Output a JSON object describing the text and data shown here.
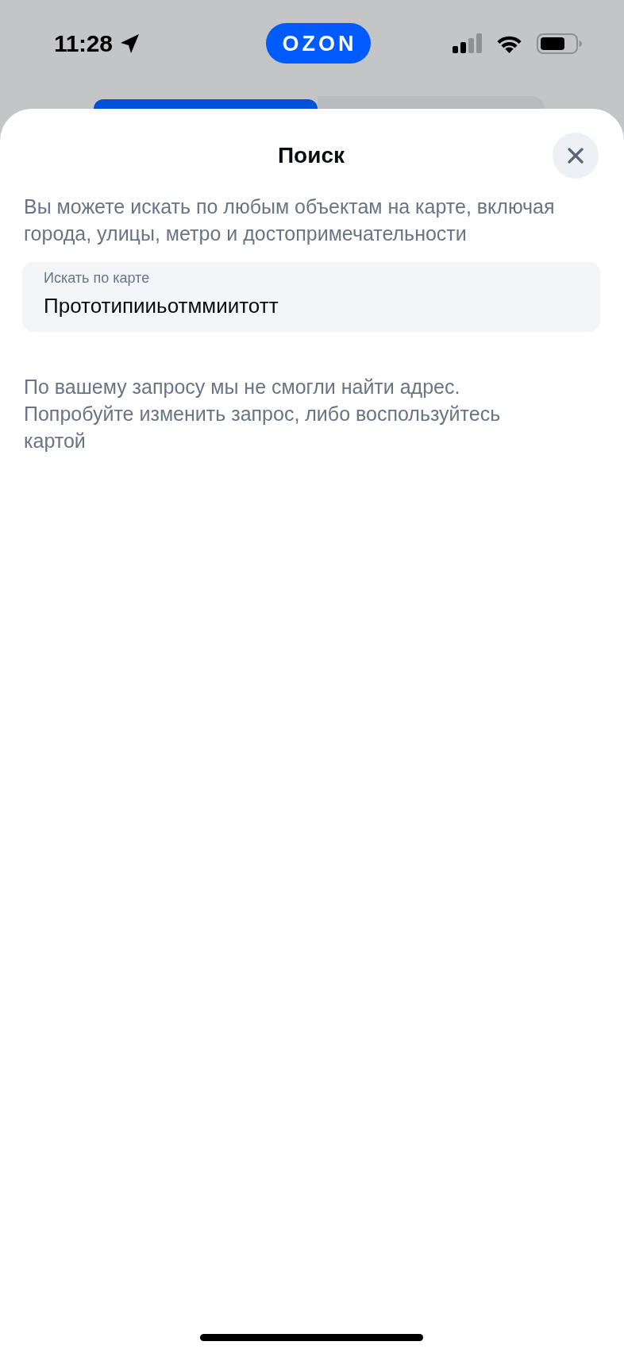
{
  "status_bar": {
    "time": "11:28",
    "app_badge": "OZON"
  },
  "background_tabs": [
    {
      "selected": true
    },
    {
      "selected": false
    }
  ],
  "sheet": {
    "title": "Поиск",
    "description": "Вы можете искать по любым объектам на карте, включая города, улицы, метро и достопримечательности",
    "search_field": {
      "label": "Искать по карте",
      "value": "Прототипииьотммиитотт"
    },
    "message": "По вашему запросу мы не смогли найти адрес. Попробуйте изменить запрос, либо воспользуйтесь картой"
  }
}
